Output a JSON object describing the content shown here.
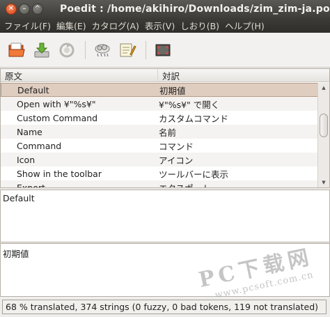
{
  "window": {
    "title": "Poedit : /home/akihiro/Downloads/zim_zim-ja.po",
    "close_glyph": "✕",
    "minimize_glyph": "–",
    "maximize_glyph": "^"
  },
  "menu": {
    "items": [
      {
        "label": "ファイル(F)"
      },
      {
        "label": "編集(E)"
      },
      {
        "label": "カタログ(A)"
      },
      {
        "label": "表示(V)"
      },
      {
        "label": "しおり(B)"
      },
      {
        "label": "ヘルプ(H)"
      }
    ]
  },
  "toolbar": {
    "icons": [
      "open-folder-icon",
      "save-download-icon",
      "update-catalog-icon",
      "validate-cloud-icon",
      "comment-edit-icon",
      "fullscreen-icon"
    ]
  },
  "list": {
    "columns": {
      "source": "原文",
      "translation": "対訳"
    },
    "rows": [
      {
        "source": "Default",
        "translation": "初期値",
        "selected": true
      },
      {
        "source": "Open with ¥\"%s¥\"",
        "translation": "¥\"%s¥\" で開く"
      },
      {
        "source": "Custom Command",
        "translation": "カスタムコマンド"
      },
      {
        "source": "Name",
        "translation": "名前"
      },
      {
        "source": "Command",
        "translation": "コマンド"
      },
      {
        "source": "Icon",
        "translation": "アイコン"
      },
      {
        "source": "Show in the toolbar",
        "translation": "ツールバーに表示"
      },
      {
        "source": "Export",
        "translation": "エクスポート"
      }
    ]
  },
  "editor": {
    "source_text": "Default",
    "translation_text": "初期値"
  },
  "watermark": {
    "brand": "PC下载网",
    "url": "www.pcsoft.com.cn"
  },
  "status": {
    "text": "68 % translated, 374 strings (0 fuzzy, 0 bad tokens, 119 not translated)"
  },
  "colors": {
    "selection": "#dfcdc0",
    "titlebar": "#3d3c38",
    "close_button": "#d9441c"
  }
}
